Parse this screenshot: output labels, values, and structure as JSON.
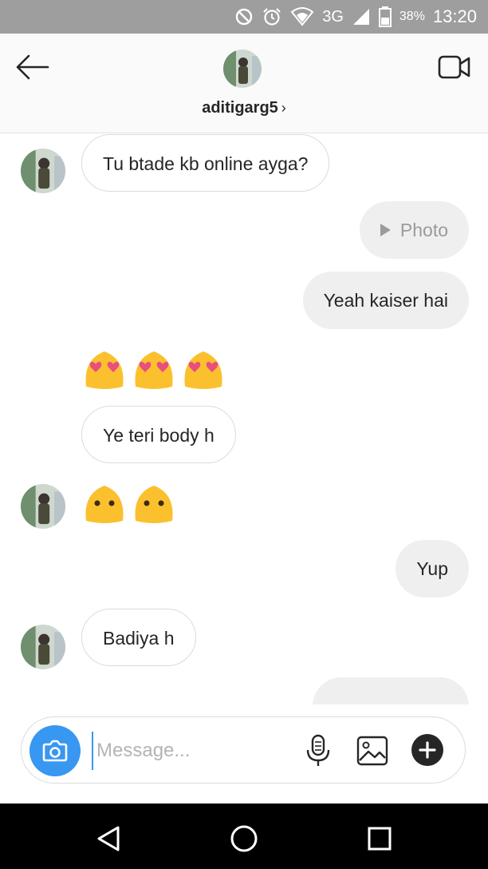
{
  "status_bar": {
    "network": "3G",
    "battery": "38%",
    "time": "13:20",
    "icons": [
      "do-not-disturb-icon",
      "alarm-icon",
      "wifi-icon",
      "signal-icon",
      "battery-icon"
    ]
  },
  "header": {
    "username": "aditigarg5",
    "chevron": "›",
    "icons": [
      "back-arrow-icon",
      "avatar",
      "video-call-icon"
    ]
  },
  "messages": [
    {
      "from": "them",
      "type": "text",
      "text": "Tu btade kb online ayga?"
    },
    {
      "from": "me",
      "type": "photo",
      "text": "Photo"
    },
    {
      "from": "me",
      "type": "text",
      "text": "Yeah kaiser hai"
    },
    {
      "from": "them",
      "type": "emoji",
      "emoji": [
        "heart-eyes-blob",
        "heart-eyes-blob",
        "heart-eyes-blob"
      ]
    },
    {
      "from": "them",
      "type": "text",
      "text": "Ye teri body h"
    },
    {
      "from": "them",
      "type": "emoji",
      "emoji": [
        "blank-face-blob",
        "blank-face-blob"
      ]
    },
    {
      "from": "me",
      "type": "text",
      "text": "Yup"
    },
    {
      "from": "them",
      "type": "text",
      "text": "Badiya h"
    },
    {
      "from": "me",
      "type": "text",
      "text": ""
    }
  ],
  "composer": {
    "placeholder": "Message...",
    "icons": [
      "camera-icon",
      "microphone-icon",
      "gallery-icon",
      "plus-icon"
    ]
  },
  "nav_bar": {
    "icons": [
      "nav-back-icon",
      "nav-home-icon",
      "nav-recents-icon"
    ]
  },
  "colors": {
    "accent": "#3897f0",
    "status_bar": "#9e9e9e",
    "outgoing_bubble": "#efefef",
    "emoji_yellow": "#fbc02d",
    "heart": "#e84e7e"
  }
}
